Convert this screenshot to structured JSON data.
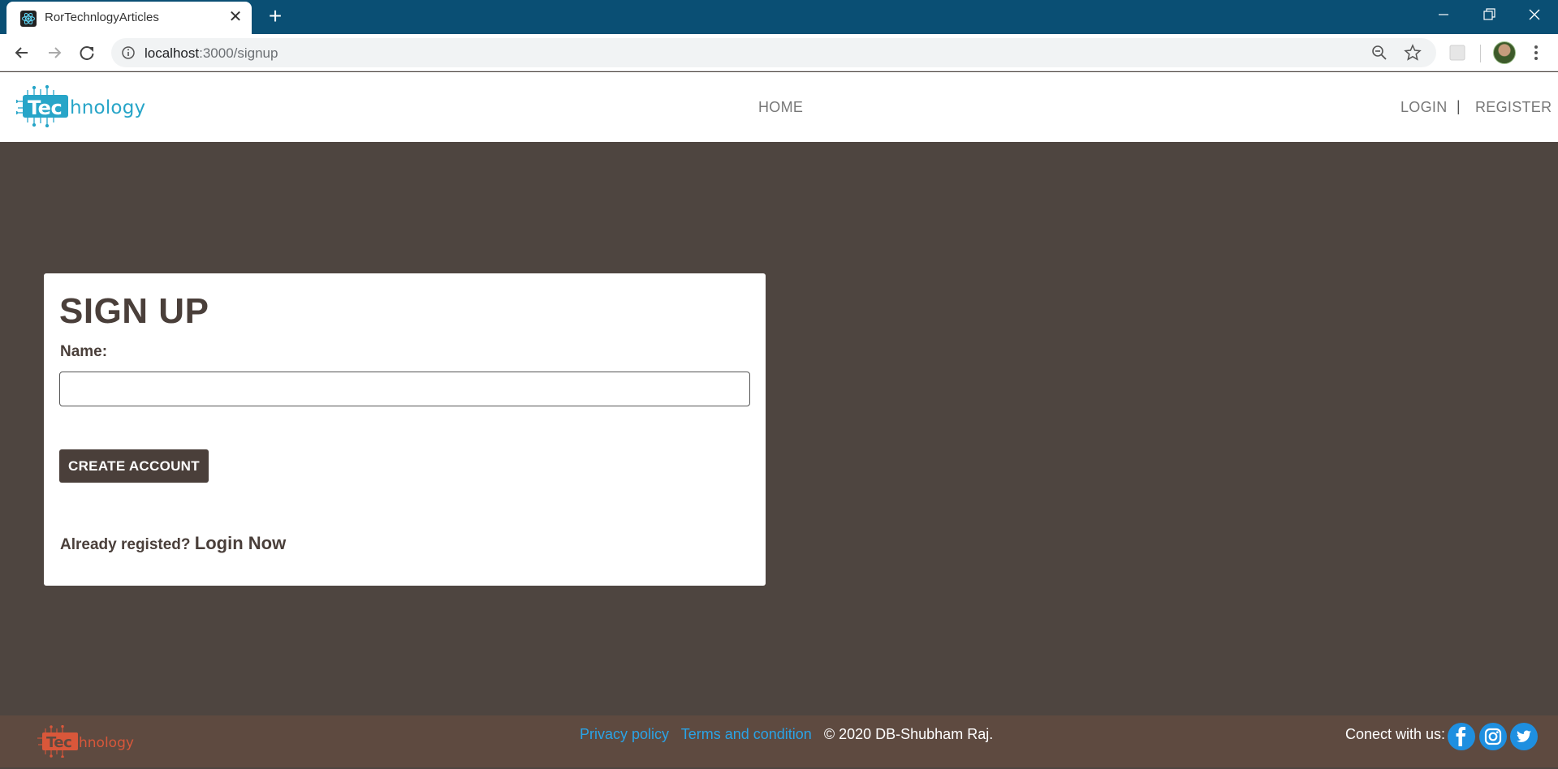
{
  "browser": {
    "tab_title": "RorTechnlogyArticles",
    "url_host": "localhost",
    "url_path": ":3000/signup"
  },
  "header": {
    "logo_main": "Tec",
    "logo_rest": "hnology",
    "nav_home": "HOME",
    "nav_login": "LOGIN",
    "nav_separator": "|",
    "nav_register": "REGISTER"
  },
  "signup": {
    "title": "SIGN UP",
    "name_label": "Name:",
    "name_value": "",
    "button_label": "CREATE ACCOUNT",
    "already_text": "Already registed?",
    "login_link": "Login Now"
  },
  "footer": {
    "privacy": "Privacy policy",
    "terms": "Terms and condition",
    "copyright": "© 2020 DB-Shubham Raj.",
    "connect": "Conect with us:"
  },
  "colors": {
    "page_bg": "#4e4540",
    "tabbar_bg": "#0a4f74",
    "footer_bg": "#5e4a40",
    "link": "#2aa3e6",
    "accent": "#4a3f3a"
  }
}
